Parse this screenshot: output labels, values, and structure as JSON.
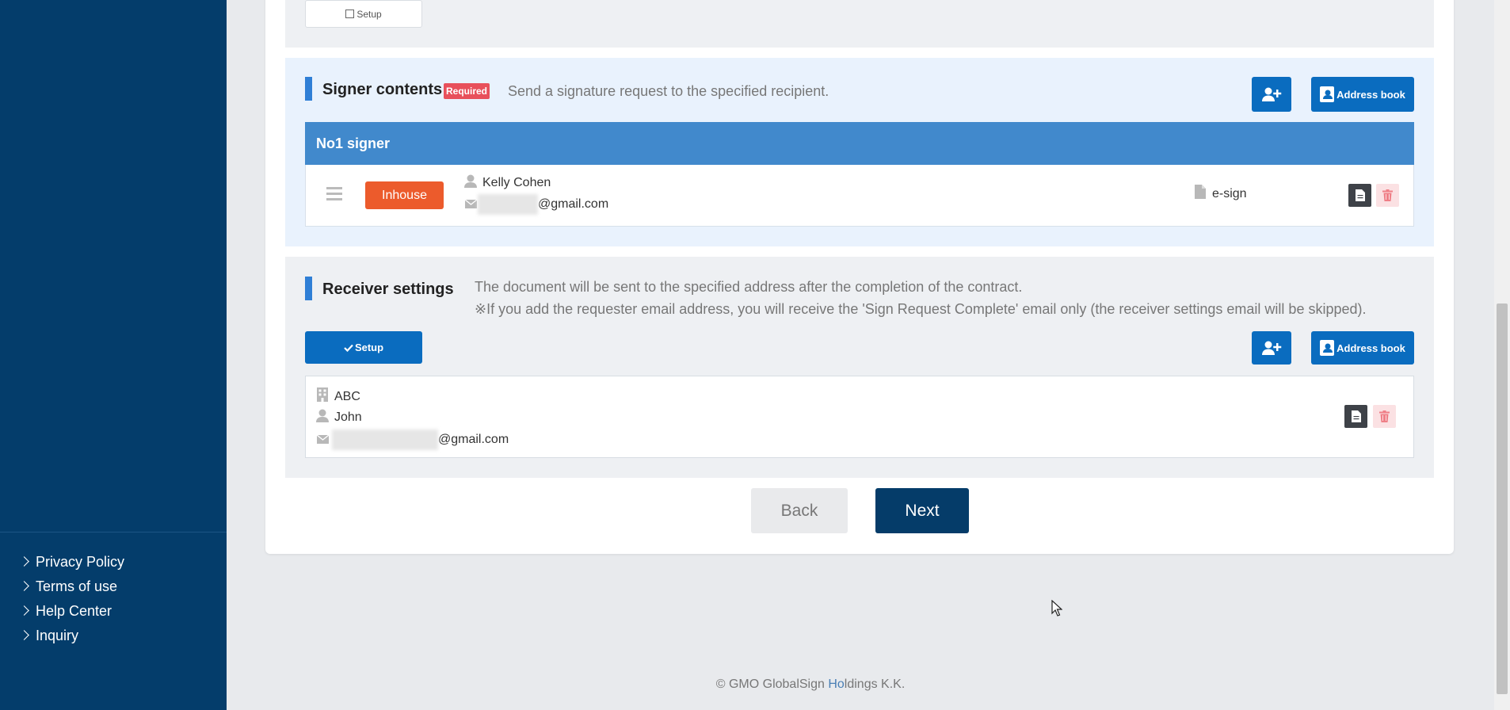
{
  "footer_links": [
    "Privacy Policy",
    "Terms of use",
    "Help Center",
    "Inquiry"
  ],
  "top_section": {
    "setup_label": "Setup"
  },
  "signer": {
    "title": "Signer contents",
    "required": "Required",
    "description": "Send a signature request to the specified recipient.",
    "address_book": "Address book",
    "header": "No1 signer",
    "type_button": "Inhouse",
    "name": "Kelly Cohen",
    "email_suffix": "@gmail.com",
    "sign_type": "e-sign"
  },
  "receiver": {
    "title": "Receiver settings",
    "desc1": "The document will be sent to the specified address after the completion of the contract.",
    "desc2": "※If you add the requester email address, you will receive the 'Sign Request Complete' email only (the receiver settings email will be skipped).",
    "setup_label": "Setup",
    "address_book": "Address book",
    "company": "ABC",
    "name": "John",
    "email_suffix": "@gmail.com"
  },
  "nav": {
    "back": "Back",
    "next": "Next"
  },
  "copyright": {
    "prefix": "© GMO GlobalSign ",
    "highlight": "Ho",
    "suffix": "ldings K.K."
  },
  "colors": {
    "sidebar": "#043d6b",
    "primary": "#0a6cbf",
    "header": "#4189cc",
    "inhouse": "#ec5b2c",
    "next": "#053c69",
    "required": "#e8505b"
  }
}
